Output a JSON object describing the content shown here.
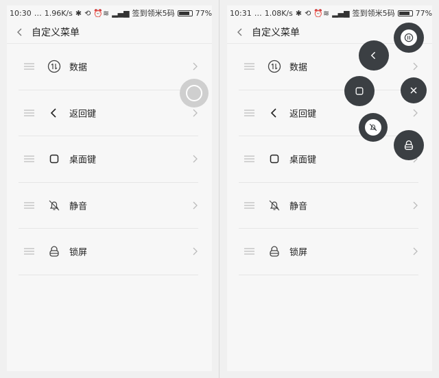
{
  "screens": [
    {
      "status": {
        "time": "10:30",
        "speed": "1.96K/s",
        "carrier": "签到领米5码",
        "battery": "77%"
      },
      "title": "自定义菜单",
      "items": [
        {
          "label": "数据",
          "icon": "data-exchange-icon"
        },
        {
          "label": "返回键",
          "icon": "back-icon"
        },
        {
          "label": "桌面键",
          "icon": "home-square-icon"
        },
        {
          "label": "静音",
          "icon": "mute-bell-icon"
        },
        {
          "label": "锁屏",
          "icon": "lock-icon"
        }
      ]
    },
    {
      "status": {
        "time": "10:31",
        "speed": "1.08K/s",
        "carrier": "签到领米5码",
        "battery": "77%"
      },
      "title": "自定义菜单",
      "items": [
        {
          "label": "数据",
          "icon": "data-exchange-icon"
        },
        {
          "label": "返回键",
          "icon": "back-icon"
        },
        {
          "label": "桌面键",
          "icon": "home-square-icon"
        },
        {
          "label": "静音",
          "icon": "mute-bell-icon"
        },
        {
          "label": "锁屏",
          "icon": "lock-icon"
        }
      ]
    }
  ],
  "colors": {
    "screen_bg": "#f7f7f7",
    "float_button": "#3b3f43",
    "assist_ball": "#cfcfcf",
    "text": "#222222"
  },
  "battery_level": 0.77
}
